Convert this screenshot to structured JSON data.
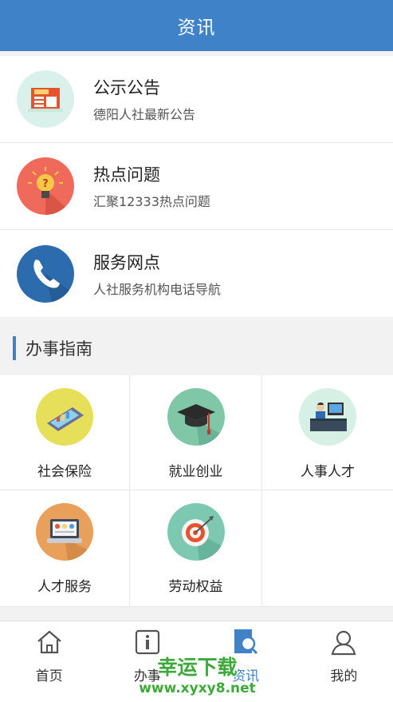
{
  "header": {
    "title": "资讯"
  },
  "news_list": [
    {
      "title": "公示公告",
      "subtitle": "德阳人社最新公告",
      "icon": "newspaper-icon",
      "bg": "#d9f1ea"
    },
    {
      "title": "热点问题",
      "subtitle": "汇聚12333热点问题",
      "icon": "lightbulb-icon",
      "bg": "#ef6a5b"
    },
    {
      "title": "服务网点",
      "subtitle": "人社服务机构电话导航",
      "icon": "phone-icon",
      "bg": "#2c6cae"
    }
  ],
  "guide": {
    "section_title": "办事指南",
    "items": [
      {
        "label": "社会保险",
        "icon": "laptop-chart-icon",
        "bg": "#e6df5a"
      },
      {
        "label": "就业创业",
        "icon": "graduation-cap-icon",
        "bg": "#7fc7a7"
      },
      {
        "label": "人事人才",
        "icon": "office-worker-icon",
        "bg": "#d6f0e6"
      },
      {
        "label": "人才服务",
        "icon": "laptop-icon",
        "bg": "#e8a05a"
      },
      {
        "label": "劳动权益",
        "icon": "target-icon",
        "bg": "#7cc8b1"
      }
    ]
  },
  "tabbar": {
    "tabs": [
      {
        "label": "首页",
        "icon": "home-icon"
      },
      {
        "label": "办事",
        "icon": "info-icon"
      },
      {
        "label": "资讯",
        "icon": "search-news-icon",
        "active": true
      },
      {
        "label": "我的",
        "icon": "user-icon"
      }
    ]
  },
  "watermark": {
    "text": "幸运下载",
    "url": "www.xyxy8.net"
  },
  "colors": {
    "primary": "#3f82c8",
    "background": "#f2f2f2",
    "watermark": "#3fa83a"
  }
}
